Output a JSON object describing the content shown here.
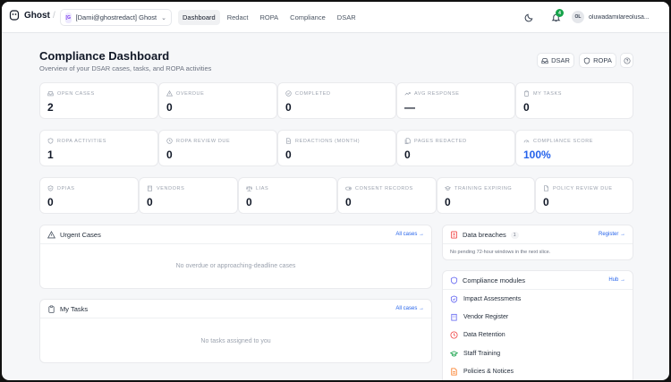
{
  "topbar": {
    "brand": "Ghost",
    "separator": "/",
    "workspace_badge": "[G",
    "workspace_name": "[Dami@ghostredact] Ghost",
    "nav": [
      "Dashboard",
      "Redact",
      "ROPA",
      "Compliance",
      "DSAR"
    ],
    "active_nav": "Dashboard",
    "notification_count": "4",
    "user_initials": "OL",
    "user_email": "oluwadamilareolusa..."
  },
  "page": {
    "title": "Compliance Dashboard",
    "subtitle": "Overview of your DSAR cases, tasks, and ROPA activities",
    "dsar_button": "DSAR",
    "ropa_button": "ROPA"
  },
  "stats_row1": [
    {
      "label": "OPEN CASES",
      "value": "2",
      "icon": "inbox-icon"
    },
    {
      "label": "OVERDUE",
      "value": "0",
      "icon": "warning-icon"
    },
    {
      "label": "COMPLETED",
      "value": "0",
      "icon": "check-circle-icon"
    },
    {
      "label": "AVG RESPONSE",
      "value": "—",
      "icon": "trend-icon"
    },
    {
      "label": "MY TASKS",
      "value": "0",
      "icon": "clipboard-icon"
    }
  ],
  "stats_row2": [
    {
      "label": "ROPA ACTIVITIES",
      "value": "1",
      "icon": "shield-icon"
    },
    {
      "label": "ROPA REVIEW DUE",
      "value": "0",
      "icon": "clock-icon"
    },
    {
      "label": "REDACTIONS (MONTH)",
      "value": "0",
      "icon": "document-icon"
    },
    {
      "label": "PAGES REDACTED",
      "value": "0",
      "icon": "pages-icon"
    },
    {
      "label": "COMPLIANCE SCORE",
      "value": "100%",
      "icon": "gauge-icon"
    }
  ],
  "stats_row3": [
    {
      "label": "DPIAS",
      "value": "0",
      "icon": "shield-check-icon"
    },
    {
      "label": "VENDORS",
      "value": "0",
      "icon": "building-icon"
    },
    {
      "label": "LIAS",
      "value": "0",
      "icon": "scale-icon"
    },
    {
      "label": "CONSENT RECORDS",
      "value": "0",
      "icon": "toggle-icon"
    },
    {
      "label": "TRAINING EXPIRING",
      "value": "0",
      "icon": "graduation-cap-icon"
    },
    {
      "label": "POLICY REVIEW DUE",
      "value": "0",
      "icon": "file-icon"
    }
  ],
  "urgent": {
    "title": "Urgent Cases",
    "link": "All cases →",
    "empty": "No overdue or approaching-deadline cases"
  },
  "tasks": {
    "title": "My Tasks",
    "link": "All cases →",
    "empty": "No tasks assigned to you"
  },
  "breaches": {
    "title": "Data breaches",
    "count": "1",
    "link": "Register →",
    "empty": "No pending 72-hour windows in the next slice."
  },
  "modules": {
    "title": "Compliance modules",
    "link": "Hub →",
    "items": [
      "Impact Assessments",
      "Vendor Register",
      "Data Retention",
      "Staff Training",
      "Policies & Notices"
    ],
    "colors": [
      "#6366f1",
      "#6366f1",
      "#ef4444",
      "#16a34a",
      "#f97316"
    ]
  }
}
